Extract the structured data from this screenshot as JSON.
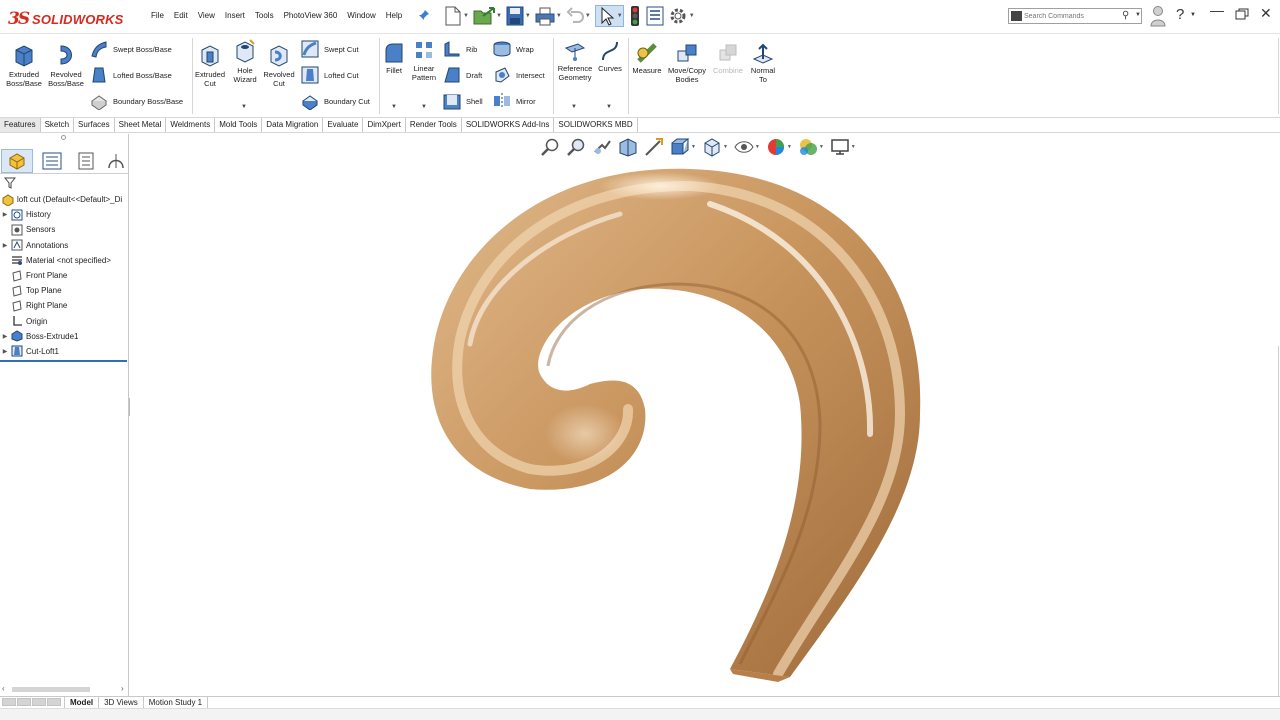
{
  "app": {
    "brand_ds": "3S",
    "brand_name": "SOLIDWORKS"
  },
  "menu": [
    "File",
    "Edit",
    "View",
    "Insert",
    "Tools",
    "PhotoView 360",
    "Window",
    "Help"
  ],
  "search": {
    "placeholder": "Search Commands"
  },
  "ribbon": {
    "extruded_boss": "Extruded\nBoss/Base",
    "revolved_boss": "Revolved\nBoss/Base",
    "swept_boss": "Swept Boss/Base",
    "lofted_boss": "Lofted Boss/Base",
    "boundary_boss": "Boundary Boss/Base",
    "extruded_cut": "Extruded\nCut",
    "hole_wizard": "Hole\nWizard",
    "revolved_cut": "Revolved\nCut",
    "swept_cut": "Swept Cut",
    "lofted_cut": "Lofted Cut",
    "boundary_cut": "Boundary Cut",
    "fillet": "Fillet",
    "linear_pattern": "Linear\nPattern",
    "rib": "Rib",
    "wrap": "Wrap",
    "draft": "Draft",
    "intersect": "Intersect",
    "shell": "Shell",
    "mirror": "Mirror",
    "reference_geometry": "Reference\nGeometry",
    "curves": "Curves",
    "measure": "Measure",
    "move_copy": "Move/Copy\nBodies",
    "combine": "Combine",
    "normal_to": "Normal\nTo"
  },
  "tabs": [
    "Features",
    "Sketch",
    "Surfaces",
    "Sheet Metal",
    "Weldments",
    "Mold Tools",
    "Data Migration",
    "Evaluate",
    "DimXpert",
    "Render Tools",
    "SOLIDWORKS Add-Ins",
    "SOLIDWORKS MBD"
  ],
  "active_tab": "Features",
  "tree": {
    "root": "loft cut  (Default<<Default>_Di",
    "items": [
      "History",
      "Sensors",
      "Annotations",
      "Material <not specified>",
      "Front Plane",
      "Top Plane",
      "Right Plane",
      "Origin",
      "Boss-Extrude1",
      "Cut-Loft1"
    ]
  },
  "bottom_tabs": [
    "Model",
    "3D Views",
    "Motion Study 1"
  ],
  "colors": {
    "brand_red": "#d52b1e",
    "wood": "#c9955e",
    "selection_blue": "#2f6fb5"
  }
}
